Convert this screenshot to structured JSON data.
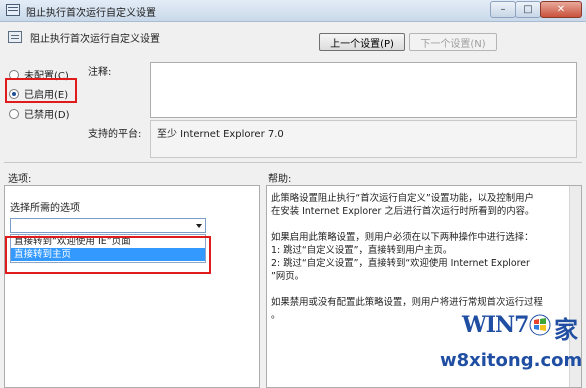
{
  "window": {
    "title": "阻止执行首次运行自定义设置",
    "min_glyph": "–",
    "max_glyph": "□",
    "close_glyph": "✕"
  },
  "header": {
    "title": "阻止执行首次运行自定义设置",
    "prev_button": "上一个设置(P)",
    "next_button": "下一个设置(N)"
  },
  "state": {
    "options": [
      {
        "label": "未配置(C)",
        "checked": false
      },
      {
        "label": "已启用(E)",
        "checked": true
      },
      {
        "label": "已禁用(D)",
        "checked": false
      }
    ]
  },
  "comment": {
    "label": "注释:"
  },
  "platform": {
    "label": "支持的平台:",
    "value": "至少 Internet Explorer 7.0"
  },
  "options_section": {
    "label": "选项:",
    "field_label": "选择所需的选项",
    "combo_value": "",
    "dropdown_items": [
      {
        "text": "直接转到“欢迎使用 IE”页面",
        "selected": false
      },
      {
        "text": "直接转到主页",
        "selected": true
      }
    ]
  },
  "help_section": {
    "label": "帮助:",
    "paragraphs": [
      [
        "此策略设置阻止执行“首次运行自定义”设置功能，以及控制用户",
        "在安装 Internet Explorer 之后进行首次运行时所看到的内容。"
      ],
      [
        "如果启用此策略设置，则用户必须在以下两种操作中进行选择：",
        "1: 跳过“自定义设置”，直接转到用户主页。",
        "2: 跳过“自定义设置”，直接转到“欢迎使用 Internet Explorer",
        "”网页。"
      ],
      [
        "如果禁用或没有配置此策略设置，则用户将进行常规首次运行过程",
        "。"
      ]
    ]
  },
  "watermark": {
    "brand": "WIN7",
    "brand_suffix": "家",
    "url": "w8xitong.com"
  },
  "colors": {
    "highlight_box": "#e01b1b",
    "selection": "#3399ff",
    "watermark": "#1f4ea3"
  }
}
